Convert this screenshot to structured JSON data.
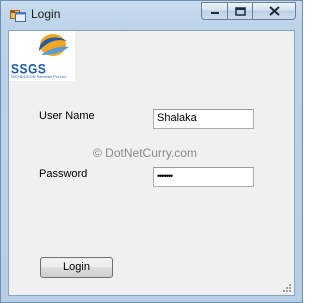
{
  "window": {
    "title": "Login",
    "icon": "windows-forms-app-icon",
    "caption_buttons": [
      "minimize-icon",
      "maximize-icon",
      "close-icon"
    ]
  },
  "logo": {
    "letters": "SSGS",
    "tagline": "TECHDUCON Services Pvt.Ltd.",
    "colors": {
      "orange": "#f4a623",
      "blue": "#1f5ca8"
    }
  },
  "form": {
    "username_label": "User Name",
    "username_value": "Shalaka",
    "password_label": "Password",
    "password_value": "•••••••",
    "login_button": "Login"
  },
  "watermark": "© DotNetCurry.com"
}
